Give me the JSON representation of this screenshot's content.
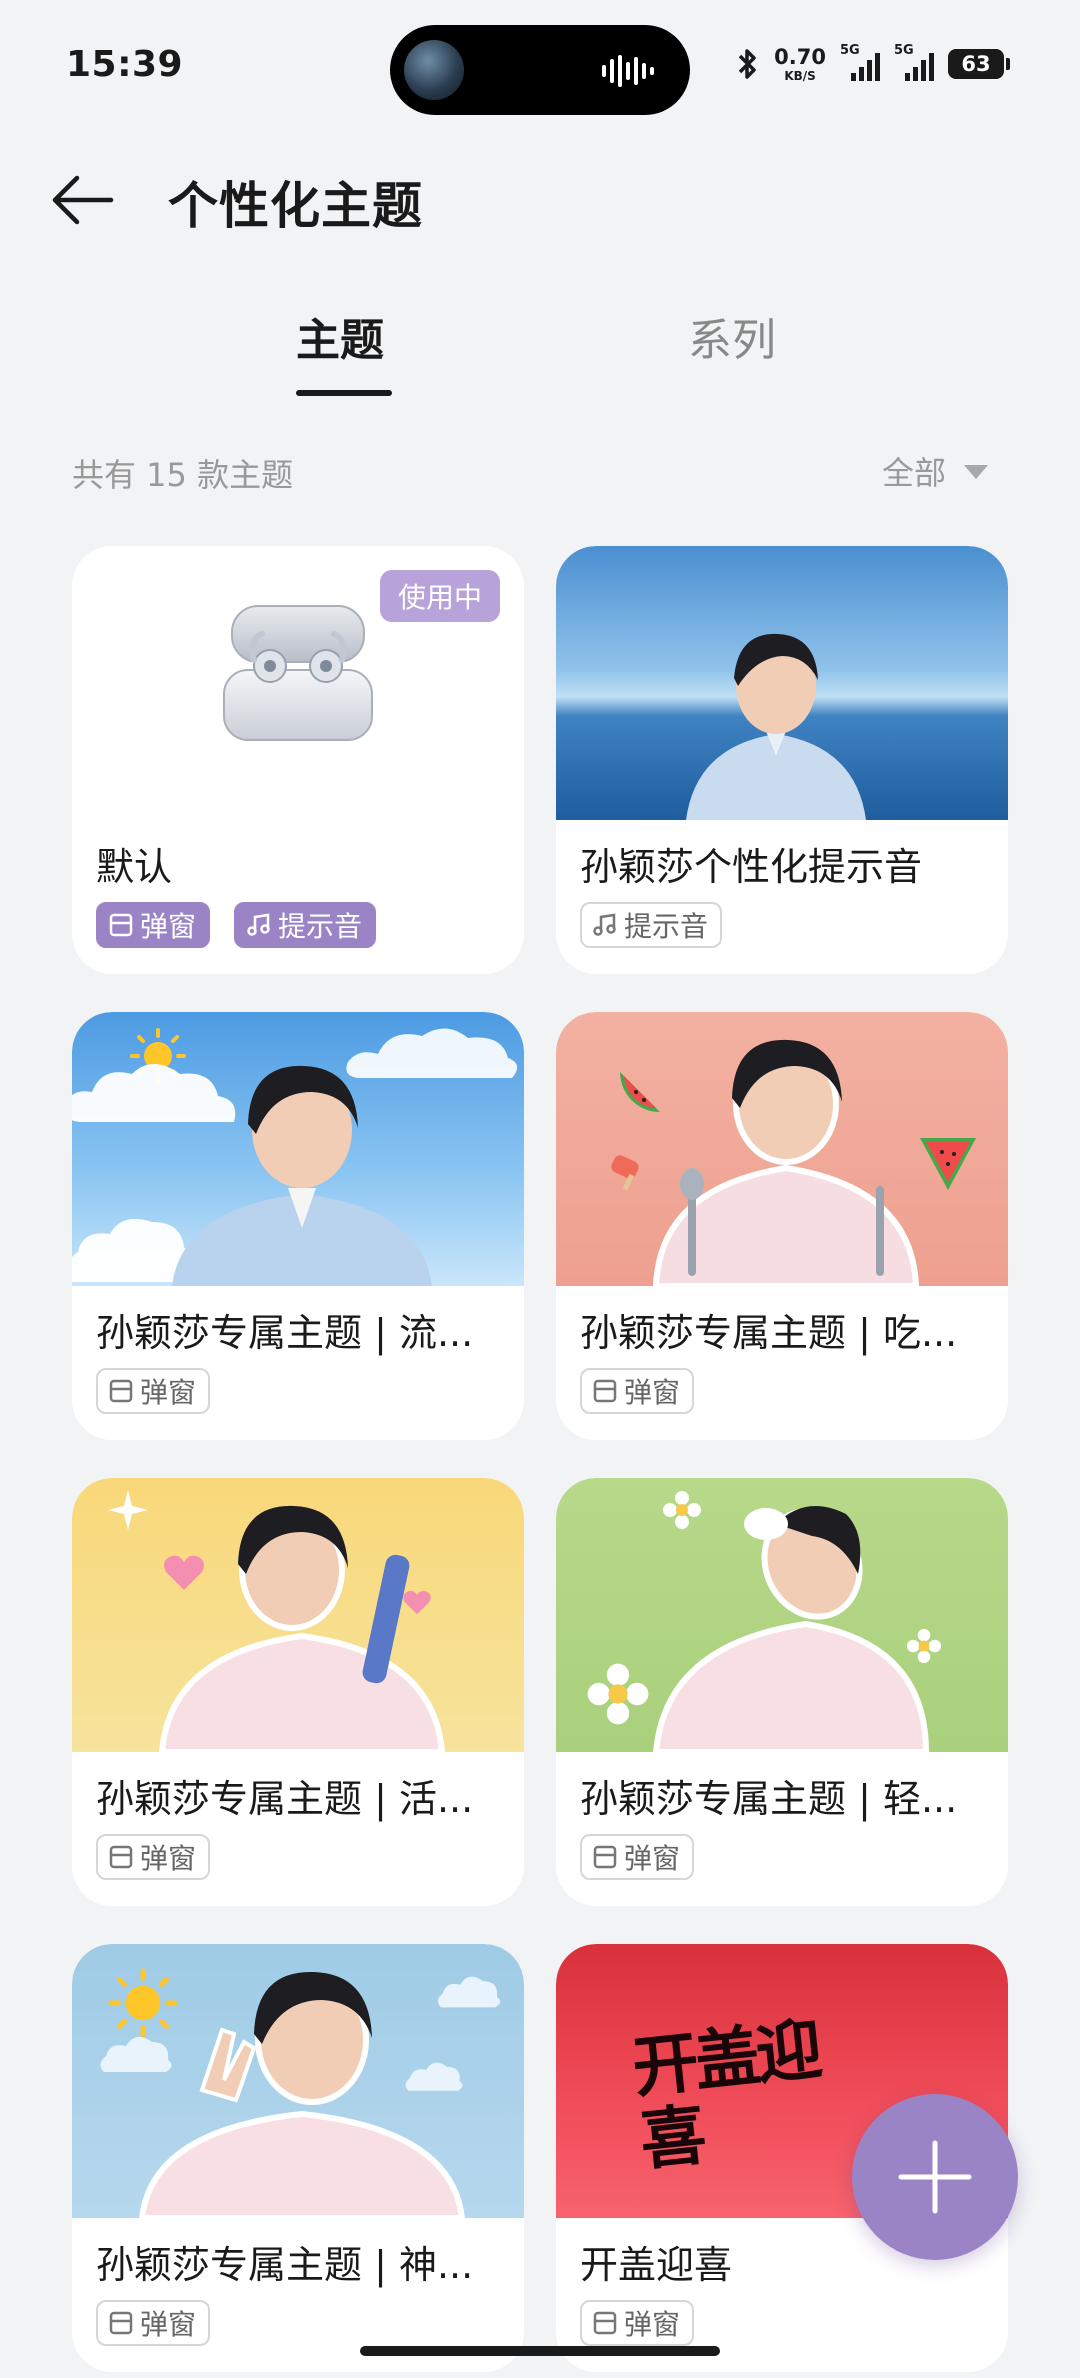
{
  "status_bar": {
    "time": "15:39",
    "net_speed_value": "0.70",
    "net_speed_unit": "KB/S",
    "sim1_label": "5G",
    "sim2_label": "5G",
    "battery": "63"
  },
  "header": {
    "title": "个性化主题"
  },
  "tabs": [
    {
      "label": "主题",
      "active": true
    },
    {
      "label": "系列",
      "active": false
    }
  ],
  "summary": {
    "count_text": "共有 15 款主题",
    "filter_label": "全部"
  },
  "themes": [
    {
      "title": "默认",
      "badge": "使用中",
      "tags": [
        {
          "icon": "popup-icon",
          "label": "弹窗",
          "filled": true
        },
        {
          "icon": "music-note-icon",
          "label": "提示音",
          "filled": true
        }
      ]
    },
    {
      "title": "孙颖莎个性化提示音",
      "tags": [
        {
          "icon": "music-note-icon",
          "label": "提示音",
          "filled": false
        }
      ]
    },
    {
      "title": "孙颖莎专属主题 | 流...",
      "tags": [
        {
          "icon": "popup-icon",
          "label": "弹窗",
          "filled": false
        }
      ]
    },
    {
      "title": "孙颖莎专属主题 | 吃...",
      "tags": [
        {
          "icon": "popup-icon",
          "label": "弹窗",
          "filled": false
        }
      ]
    },
    {
      "title": "孙颖莎专属主题 | 活...",
      "tags": [
        {
          "icon": "popup-icon",
          "label": "弹窗",
          "filled": false
        }
      ]
    },
    {
      "title": "孙颖莎专属主题 | 轻...",
      "tags": [
        {
          "icon": "popup-icon",
          "label": "弹窗",
          "filled": false
        }
      ]
    },
    {
      "title": "孙颖莎专属主题 | 神...",
      "tags": [
        {
          "icon": "popup-icon",
          "label": "弹窗",
          "filled": false
        }
      ]
    },
    {
      "title": "开盖迎喜",
      "thumb_text": "开盖迎喜",
      "tags": [
        {
          "icon": "popup-icon",
          "label": "弹窗",
          "filled": false
        }
      ]
    }
  ],
  "colors": {
    "accent": "#9b84c6",
    "background": "#f1f3f5"
  }
}
